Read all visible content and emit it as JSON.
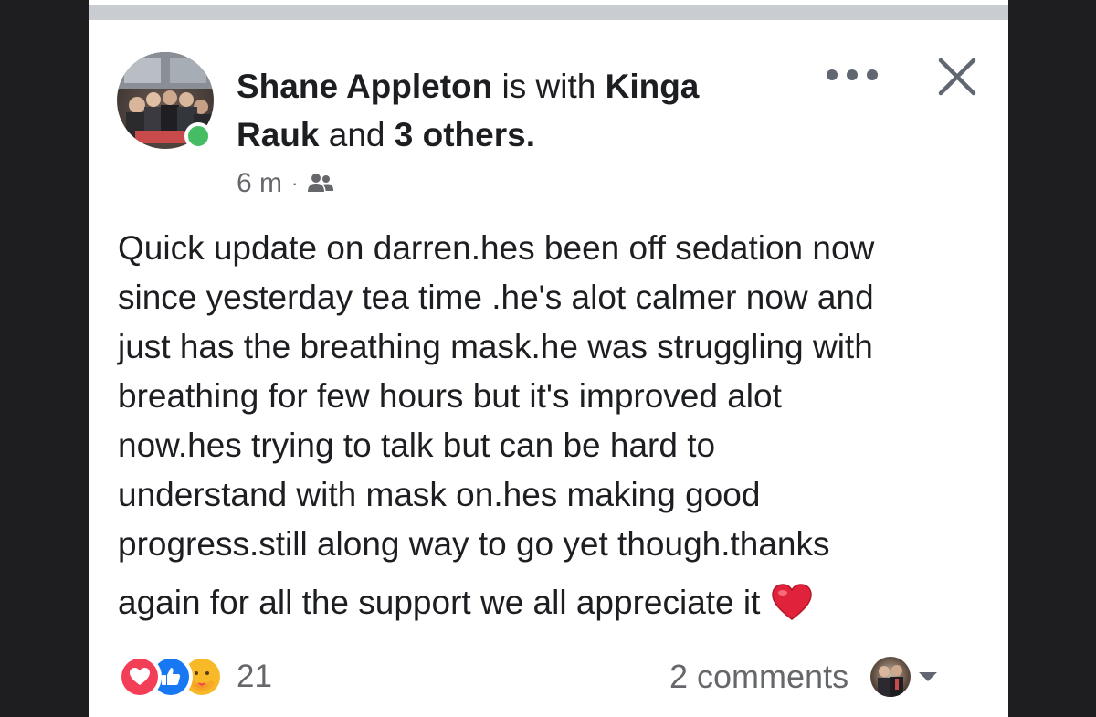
{
  "post": {
    "author": "Shane Appleton",
    "with_text": " is with ",
    "tagged_person_1": "Kinga",
    "tagged_person_2": "Rauk",
    "and_text": " and ",
    "others": "3 others.",
    "timestamp": "6 m",
    "separator": "·",
    "audience_icon": "friends-icon",
    "body_lines": [
      "Quick update on darren.hes been off sedation now",
      "since yesterday tea time .he's alot calmer now and",
      "just has the breathing mask.he was struggling with",
      "breathing for few hours but it's improved alot",
      "now.hes  trying to talk but can be hard to",
      "understand with mask on.hes making good",
      "progress.still along way to go yet though.thanks",
      "again for all the support we all appreciate it"
    ],
    "body_emoji": "red-heart-icon"
  },
  "footer": {
    "reaction_icons": [
      "love-reaction-icon",
      "like-reaction-icon",
      "care-reaction-icon"
    ],
    "reaction_count": "21",
    "comments_label": "2 comments"
  },
  "colors": {
    "online": "#45bd62",
    "love": "#f33e58",
    "like": "#1877f2",
    "care": "#f7b928",
    "secondary_text": "#65676b"
  }
}
